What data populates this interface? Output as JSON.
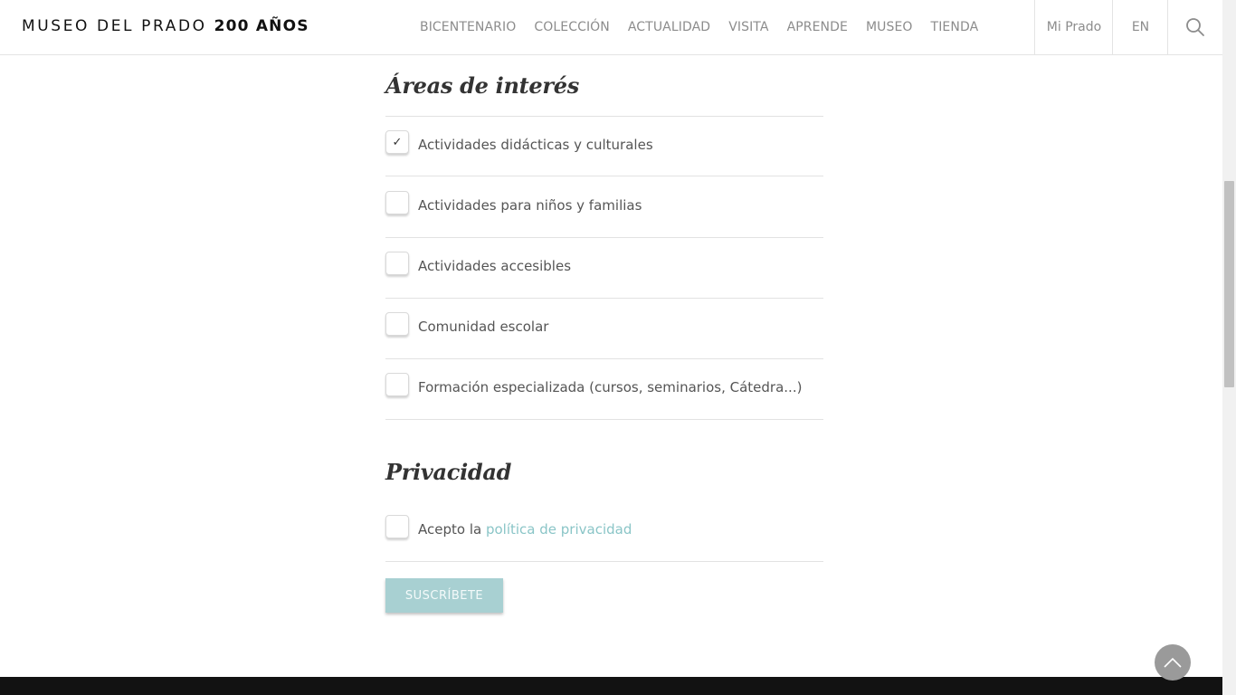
{
  "header": {
    "logo_text": "MUSEO DEL PRADO",
    "logo_bold": "200 AÑOS",
    "nav": [
      "BICENTENARIO",
      "COLECCIÓN",
      "ACTUALIDAD",
      "VISITA",
      "APRENDE",
      "MUSEO",
      "TIENDA"
    ],
    "account_label": "Mi Prado",
    "language_label": "EN",
    "search_icon": "search-icon"
  },
  "interests": {
    "title": "Áreas de interés",
    "items": [
      {
        "label": "Actividades didácticas y culturales",
        "checked": true
      },
      {
        "label": "Actividades para niños y familias",
        "checked": false
      },
      {
        "label": "Actividades accesibles",
        "checked": false
      },
      {
        "label": "Comunidad escolar",
        "checked": false
      },
      {
        "label": "Formación especializada (cursos, seminarios, Cátedra...)",
        "checked": false
      }
    ]
  },
  "privacy": {
    "title": "Privacidad",
    "accept_prefix": "Acepto la",
    "policy_link": "política de privacidad",
    "checked": false
  },
  "submit_label": "SUSCRÍBETE",
  "icons": {
    "checkmark": "✓",
    "back_to_top": "chevron-up-icon"
  },
  "colors": {
    "accent": "#8ac5c7",
    "button": "#a8d0d2",
    "footer": "#121212"
  }
}
